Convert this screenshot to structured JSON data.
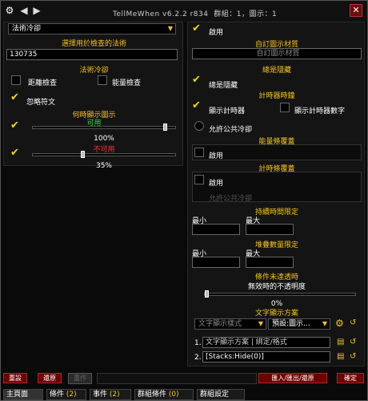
{
  "window": {
    "title": "TellMeWhen v6.2.2 r834",
    "group_info": "群組：1，圖示：1",
    "colors": {
      "accent": "#f4c21a",
      "close_bg": "#6b0d0d",
      "check": "#f4d21a",
      "good": "#3cdc3c",
      "bad": "#ff3030"
    }
  },
  "left": {
    "type_dropdown": "法術冷卻",
    "select_header": "選擇用於檢查的法術",
    "spell_value": "130735",
    "section_header": "法術冷卻",
    "range_check": "距離檢查",
    "mana_check": "能量檢查",
    "ignore_runes": "忽略符文",
    "when_show_header": "何時顯示圖示",
    "usable_label": "可用",
    "usable_percent": "100%",
    "usable_value": 1.0,
    "unusable_label": "不可用",
    "unusable_percent": "35%",
    "unusable_value": 0.35
  },
  "right": {
    "enabled": "啟用",
    "custom_texture_header": "自訂圖示材質",
    "custom_texture_placeholder": "自訂圖示材質",
    "always_hide_header": "總是隱藏",
    "always_hide": "總是隱藏",
    "timer_header": "計時器時鐘",
    "show_timer": "顯示計時器",
    "show_timer_text": "顯示計時器數字",
    "allow_gcd": "允許公共冷卻",
    "mana_dim_header": "能量條覆蓋",
    "mana_enable": "啟用",
    "timer_bar_header": "計時條覆蓋",
    "timer_bar_enable": "啟用",
    "timer_bar_invert": "允許公共冷卻",
    "duration_header": "持續時間限定",
    "duration_min": "最小",
    "duration_max": "最大",
    "stacks_header": "堆疊數量限定",
    "stacks_min": "最小",
    "stacks_max": "最大",
    "unmet_header": "條件未達透時",
    "unmet_alpha_label": "無效時的不透明度",
    "unmet_alpha_percent": "0%",
    "unmet_alpha_value": 0.0,
    "text_display_header": "文字顯示方案",
    "text_layout_dropdown": "文字顯示樣式",
    "text_preset_dropdown": "預設:圖示...",
    "text_line1": "文字顯示方案 | 綁定/格式",
    "text_line2_num": "2.",
    "text_line2": "[Stacks:Hide(0)]",
    "text_line1_num": "1."
  },
  "bottom": {
    "reset": "重設",
    "restore": "還原",
    "redo": "重作",
    "import_export": "匯入/匯出/還原",
    "ok": "確定"
  },
  "tabs": [
    {
      "label": "主頁面"
    },
    {
      "label": "條件",
      "count": "(2)"
    },
    {
      "label": "事件",
      "count": "(2)"
    },
    {
      "label": "群組條件",
      "count": "(0)"
    },
    {
      "label": "群組設定"
    }
  ]
}
